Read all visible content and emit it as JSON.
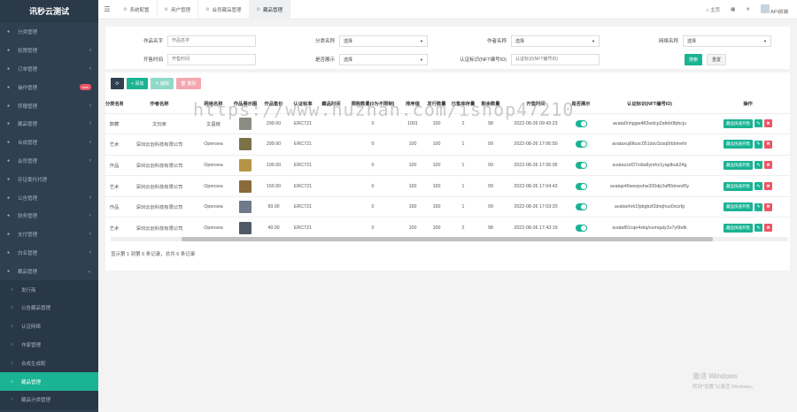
{
  "brand": "讯秒云测试",
  "sidebar": {
    "items": [
      {
        "label": "分类管理",
        "arrow": ""
      },
      {
        "label": "权限管理",
        "arrow": "‹"
      },
      {
        "label": "订单管理",
        "arrow": "‹"
      },
      {
        "label": "操作管理",
        "badge": "new"
      },
      {
        "label": "转赠管理",
        "arrow": "‹"
      },
      {
        "label": "藏品管理",
        "arrow": "‹"
      },
      {
        "label": "合成管理",
        "arrow": "‹"
      },
      {
        "label": "会员管理",
        "arrow": "‹"
      },
      {
        "label": "存证委托代理",
        "arrow": ""
      },
      {
        "label": "公告管理",
        "arrow": "‹"
      },
      {
        "label": "财务管理",
        "arrow": "‹"
      },
      {
        "label": "支付管理",
        "arrow": "‹"
      },
      {
        "label": "白名管理",
        "arrow": "‹"
      },
      {
        "label": "藏品管理",
        "arrow": "⌄"
      }
    ],
    "subitems": [
      {
        "label": "发行商",
        "active": false
      },
      {
        "label": "公告藏品管理",
        "active": false
      },
      {
        "label": "认证网络",
        "active": false
      },
      {
        "label": "作家管理",
        "active": false
      },
      {
        "label": "合成生成配",
        "active": false
      },
      {
        "label": "藏品管理",
        "active": true
      },
      {
        "label": "藏品分类管理",
        "active": false
      }
    ]
  },
  "topbar": {
    "tabs": [
      {
        "label": "系统配置",
        "active": false
      },
      {
        "label": "用户管理",
        "active": false
      },
      {
        "label": "会员藏品管理",
        "active": false
      },
      {
        "label": "藏品管理",
        "active": true
      }
    ],
    "home": "主页",
    "user": "API前端"
  },
  "search": {
    "fields": [
      {
        "label": "作品名字",
        "placeholder": "作品名字"
      },
      {
        "label": "分类名称",
        "value": "选择"
      },
      {
        "label": "作者名称",
        "value": "选择"
      },
      {
        "label": "网络名称",
        "value": "选择"
      },
      {
        "label": "开售时间",
        "placeholder": "开售时间"
      },
      {
        "label": "是否展示",
        "value": "选择"
      },
      {
        "label": "认证标识(NFT编号ID)",
        "placeholder": "认证标识(NFT编号ID)"
      }
    ],
    "search_label": "搜索",
    "reset_label": "重置"
  },
  "toolbar": {
    "add": "+ 添加",
    "edit": "✎ 编辑",
    "del": "🗑 删除"
  },
  "table": {
    "columns": [
      "分类名称",
      "作者名称",
      "网络名称",
      "作品展示图",
      "作品售价",
      "认证标准",
      "藏品时间",
      "限购数量(0为不限制)",
      "排序值",
      "发行数量",
      "已售库存量",
      "剩余数量",
      "开售时间",
      "是否展示",
      "认证标识(NFT编号ID)",
      "操作"
    ],
    "rows": [
      {
        "c0": "数藏",
        "c1": "文玩家",
        "c2": "文昌链",
        "thumb": "#8c8c85",
        "c4": "299.00",
        "c5": "ERC721",
        "c6": "",
        "c7": "0",
        "c8": "1001",
        "c9": "100",
        "c10": "2",
        "c11": "98",
        "c12": "2022-08-26 09:43:23",
        "c14": "avata0nhggw483wdcp2afeb0fpbcju",
        "op": "藏品快速开售"
      },
      {
        "c0": "艺术",
        "c1": "深圳云创科技有限公司",
        "c2": "Opensea",
        "thumb": "#7a7348",
        "c4": "299.00",
        "c5": "ERC721",
        "c6": "",
        "c7": "0",
        "c8": "100",
        "c9": "100",
        "c10": "1",
        "c11": "99",
        "c12": "2022-08-26 17:06:50",
        "c14": "avataxuj6ltusc051dsv3zsq0rbbmehr",
        "op": "藏品快速开售"
      },
      {
        "c0": "作品",
        "c1": "深圳云创科技有限公司",
        "c2": "Opensea",
        "thumb": "#b59545",
        "c4": "199.00",
        "c5": "ERC721",
        "c6": "",
        "c7": "0",
        "c8": "100",
        "c9": "100",
        "c10": "1",
        "c11": "99",
        "c12": "2022-08-26 17:06:05",
        "c14": "avatazzsf37vlda8ymhz1yaplbub24g",
        "op": "藏品快速开售"
      },
      {
        "c0": "艺术",
        "c1": "深圳云创科技有限公司",
        "c2": "Opensea",
        "thumb": "#8a6a3b",
        "c4": "150.00",
        "c5": "ERC721",
        "c6": "",
        "c7": "0",
        "c8": "100",
        "c9": "100",
        "c10": "1",
        "c11": "99",
        "c12": "2022-08-26 17:04:43",
        "c14": "avatap49wxepshw300dp2aff0dvwsf0y",
        "op": "藏品快速开售"
      },
      {
        "c0": "作品",
        "c1": "深圳云创科技有限公司",
        "c2": "Opensea",
        "thumb": "#6f7a88",
        "c4": "99.00",
        "c5": "ERC721",
        "c6": "",
        "c7": "0",
        "c8": "100",
        "c9": "100",
        "c10": "1",
        "c11": "99",
        "c12": "2022-08-26 17:03:20",
        "c14": "avataehrk1fpbgbzf2dnqhus0xzzfg",
        "op": "藏品快速开售"
      },
      {
        "c0": "艺术",
        "c1": "深圳云创科技有限公司",
        "c2": "Opensea",
        "thumb": "#4f5a66",
        "c4": "49.00",
        "c5": "ERC721",
        "c6": "",
        "c7": "0",
        "c8": "100",
        "c9": "100",
        "c10": "2",
        "c11": "98",
        "c12": "2022-08-26 17:43:19",
        "c14": "avataf81cqe4xkq/vumqaly3u7y0bdk",
        "op": "藏品快速开售"
      }
    ]
  },
  "footer": {
    "info": "显示第 1 到第 6 条记录，总共 6 条记录"
  },
  "watermark": "https://www.huzhan.com/ishop47210",
  "activate": {
    "line1": "激活 Windows",
    "line2": "转到\"设置\"以激活 Windows。"
  }
}
